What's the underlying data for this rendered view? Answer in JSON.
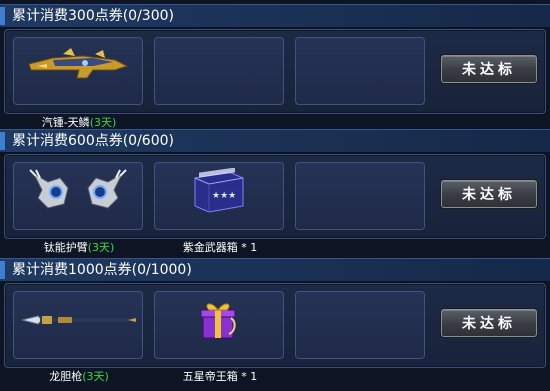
{
  "tiers": [
    {
      "title": "累计消费300点券(0/300)",
      "rewards": [
        {
          "name": "汽锺-天鳞",
          "duration": "(3天)",
          "icon": "golden-dragon-rifle-icon"
        }
      ],
      "button_label": "未达标"
    },
    {
      "title": "累计消费600点券(0/600)",
      "rewards": [
        {
          "name": "钛能护臂",
          "duration": "(3天)",
          "icon": "armguard-icon"
        },
        {
          "name": "紫金武器箱 * 1",
          "duration": "",
          "icon": "weapon-box-icon"
        }
      ],
      "button_label": "未达标"
    },
    {
      "title": "累计消费1000点券(0/1000)",
      "rewards": [
        {
          "name": "龙胆枪",
          "duration": "(3天)",
          "icon": "spear-icon"
        },
        {
          "name": "五星帝王箱 * 1",
          "duration": "",
          "icon": "gift-box-icon"
        }
      ],
      "button_label": "未达标"
    }
  ],
  "colors": {
    "background": "#0d1424",
    "header": "#1f3a64",
    "panel": "#1d2a45",
    "duration_text": "#33dd44"
  }
}
